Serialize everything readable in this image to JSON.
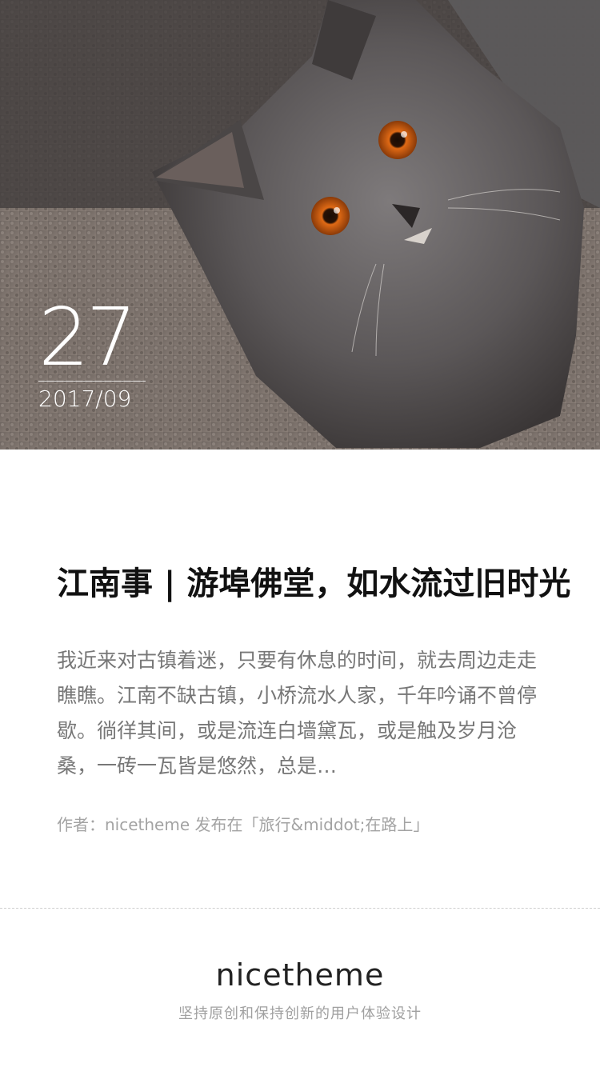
{
  "hero": {
    "image_subject": "gray-cat-photo",
    "day": "27",
    "year_month": "2017/09"
  },
  "article": {
    "title": "江南事 | 游埠佛堂，如水流过旧时光",
    "excerpt": "我近来对古镇着迷，只要有休息的时间，就去周边走走瞧瞧。江南不缺古镇，小桥流水人家，千年吟诵不曾停歇。徜徉其间，或是流连白墙黛瓦，或是触及岁月沧桑，一砖一瓦皆是悠然，总是…",
    "meta": "作者：nicetheme 发布在「旅行&middot;在路上」"
  },
  "footer": {
    "brand": "nicetheme",
    "slogan": "坚持原创和保持创新的用户体验设计"
  }
}
